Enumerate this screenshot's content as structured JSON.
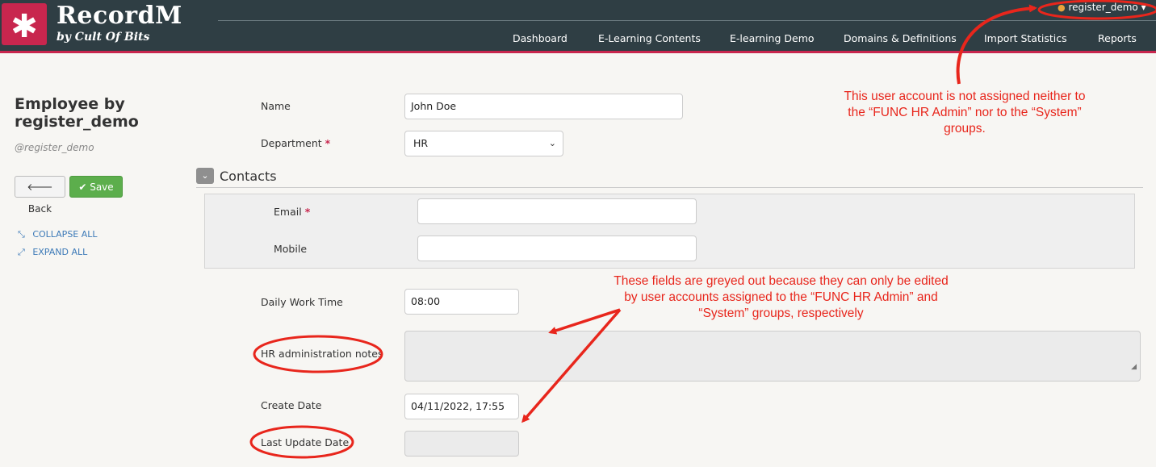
{
  "app": {
    "logo_glyph": "✱",
    "brand_name": "RecordM",
    "brand_tagline": "by Cult Of Bits",
    "user": "register_demo",
    "user_caret": "▾",
    "user_icon": "●"
  },
  "nav": {
    "items": [
      "Dashboard",
      "E-Learning Contents",
      "E-learning Demo",
      "Domains & Definitions",
      "Import Statistics",
      "Reports"
    ]
  },
  "sidebar": {
    "title": "Employee by register_demo",
    "subtitle": "@register_demo",
    "back_label": "Back",
    "back_icon": "🡐",
    "save_label": "Save",
    "save_icon": "✔",
    "collapse_label": "COLLAPSE ALL",
    "expand_label": "EXPAND ALL",
    "collapse_icon": "⤡",
    "expand_icon": "⤢"
  },
  "form": {
    "name_label": "Name",
    "name_value": "John Doe",
    "department_label": "Department",
    "department_value": "HR",
    "required_mark": "*",
    "contacts_title": "Contacts",
    "contacts_toggle_icon": "⌄",
    "email_label": "Email",
    "email_value": "",
    "mobile_label": "Mobile",
    "mobile_value": "",
    "daily_work_time_label": "Daily Work Time",
    "daily_work_time_value": "08:00",
    "hr_notes_label": "HR administration notes",
    "hr_notes_value": "",
    "create_date_label": "Create Date",
    "create_date_value": "04/11/2022, 17:55",
    "last_update_label": "Last Update Date",
    "last_update_value": ""
  },
  "annotations": {
    "account_note": "This user account is not assigned neither to the “FUNC HR Admin” nor to the “System” groups.",
    "greyed_note": "These fields are greyed out because they can only be edited by user accounts assigned to the “FUNC HR Admin” and “System” groups, respectively"
  },
  "colors": {
    "topbar": "#2f3e44",
    "accent": "#c8264e",
    "save_green": "#5cae4c",
    "annotation_red": "#e8261c"
  }
}
